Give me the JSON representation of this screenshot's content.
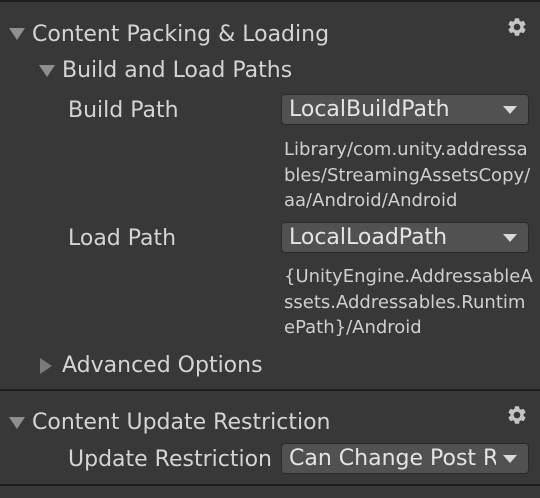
{
  "content_packing": {
    "title": "Content Packing & Loading",
    "settings_icon": "gear-icon",
    "build_and_load_paths": {
      "title": "Build and Load Paths",
      "build_path": {
        "label": "Build Path",
        "value": "LocalBuildPath",
        "resolved": "Library/com.unity.addressables/StreamingAssetsCopy/aa/Android/Android"
      },
      "load_path": {
        "label": "Load Path",
        "value": "LocalLoadPath",
        "resolved": "{UnityEngine.AddressableAssets.Addressables.RuntimePath}/Android"
      }
    },
    "advanced_options": {
      "title": "Advanced Options"
    }
  },
  "content_update": {
    "title": "Content Update Restriction",
    "settings_icon": "gear-icon",
    "update_restriction": {
      "label": "Update Restriction",
      "value": "Can Change Post Release"
    }
  },
  "colors": {
    "panel_background": "#383838",
    "dropdown_background": "#515151",
    "divider": "#1e1e1e",
    "text": "#d4d4d4"
  }
}
